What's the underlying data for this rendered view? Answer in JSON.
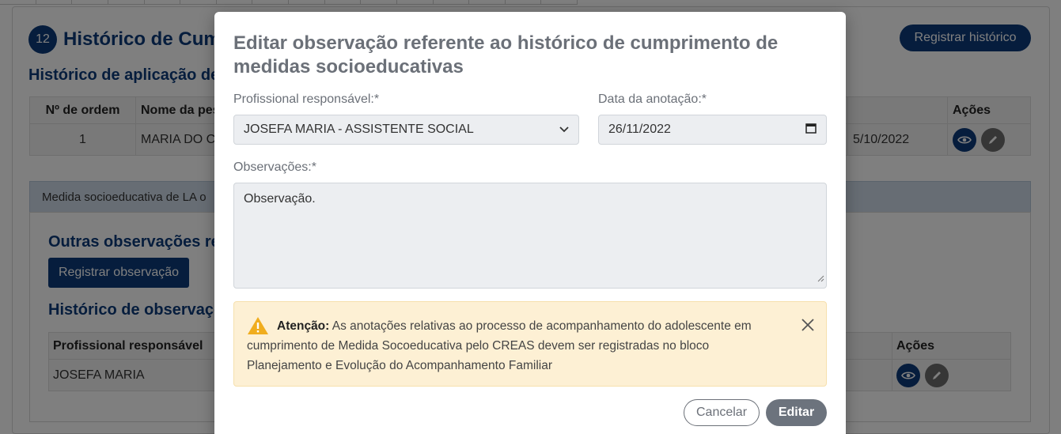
{
  "background": {
    "section_number": "12",
    "section_title": "Histórico de Cum",
    "register_history_button": "Registrar histórico",
    "subtitle": "Histórico de aplicação de",
    "table1": {
      "headers": [
        "Nº de ordem",
        "Nome da pes",
        "Ações"
      ],
      "row": [
        "1",
        "MARIA DO CA",
        "5/10/2022"
      ]
    },
    "tab_label": "Medida socioeducativa de LA o",
    "other_obs_title": "Outras observações ref",
    "register_obs_button": "Registrar observação",
    "history_obs_title": "Histórico de observaçõ",
    "table2": {
      "headers": [
        "Profissional responsável",
        "Ações"
      ],
      "row": [
        "JOSEFA MARIA"
      ]
    }
  },
  "modal": {
    "title": "Editar observação referente ao histórico de cumprimento de medidas socioeducativas",
    "professional_label": "Profissional responsável:*",
    "professional_value": "JOSEFA MARIA - ASSISTENTE SOCIAL",
    "date_label": "Data da anotação:*",
    "date_value": "26/11/2022",
    "observations_label": "Observações:*",
    "observations_value": "Observação.",
    "alert": {
      "strong": "Atenção:",
      "text": " As anotações relativas ao processo de acompanhamento do adolescente em cumprimento de Medida Socoeducativa pelo CREAS devem ser registradas no bloco Planejamento e Evolução do Acompanhamento Familiar"
    },
    "cancel_button": "Cancelar",
    "edit_button": "Editar"
  },
  "icons": {
    "dropdown": "chevron-down-icon",
    "calendar": "calendar-icon",
    "warning": "warning-icon",
    "close": "close-icon",
    "view": "eye-icon",
    "edit": "pencil-icon"
  },
  "colors": {
    "primary": "#0d3b7a",
    "alert_bg": "#fdf0d4",
    "warning": "#f0ad1e",
    "muted": "#6b7078"
  }
}
